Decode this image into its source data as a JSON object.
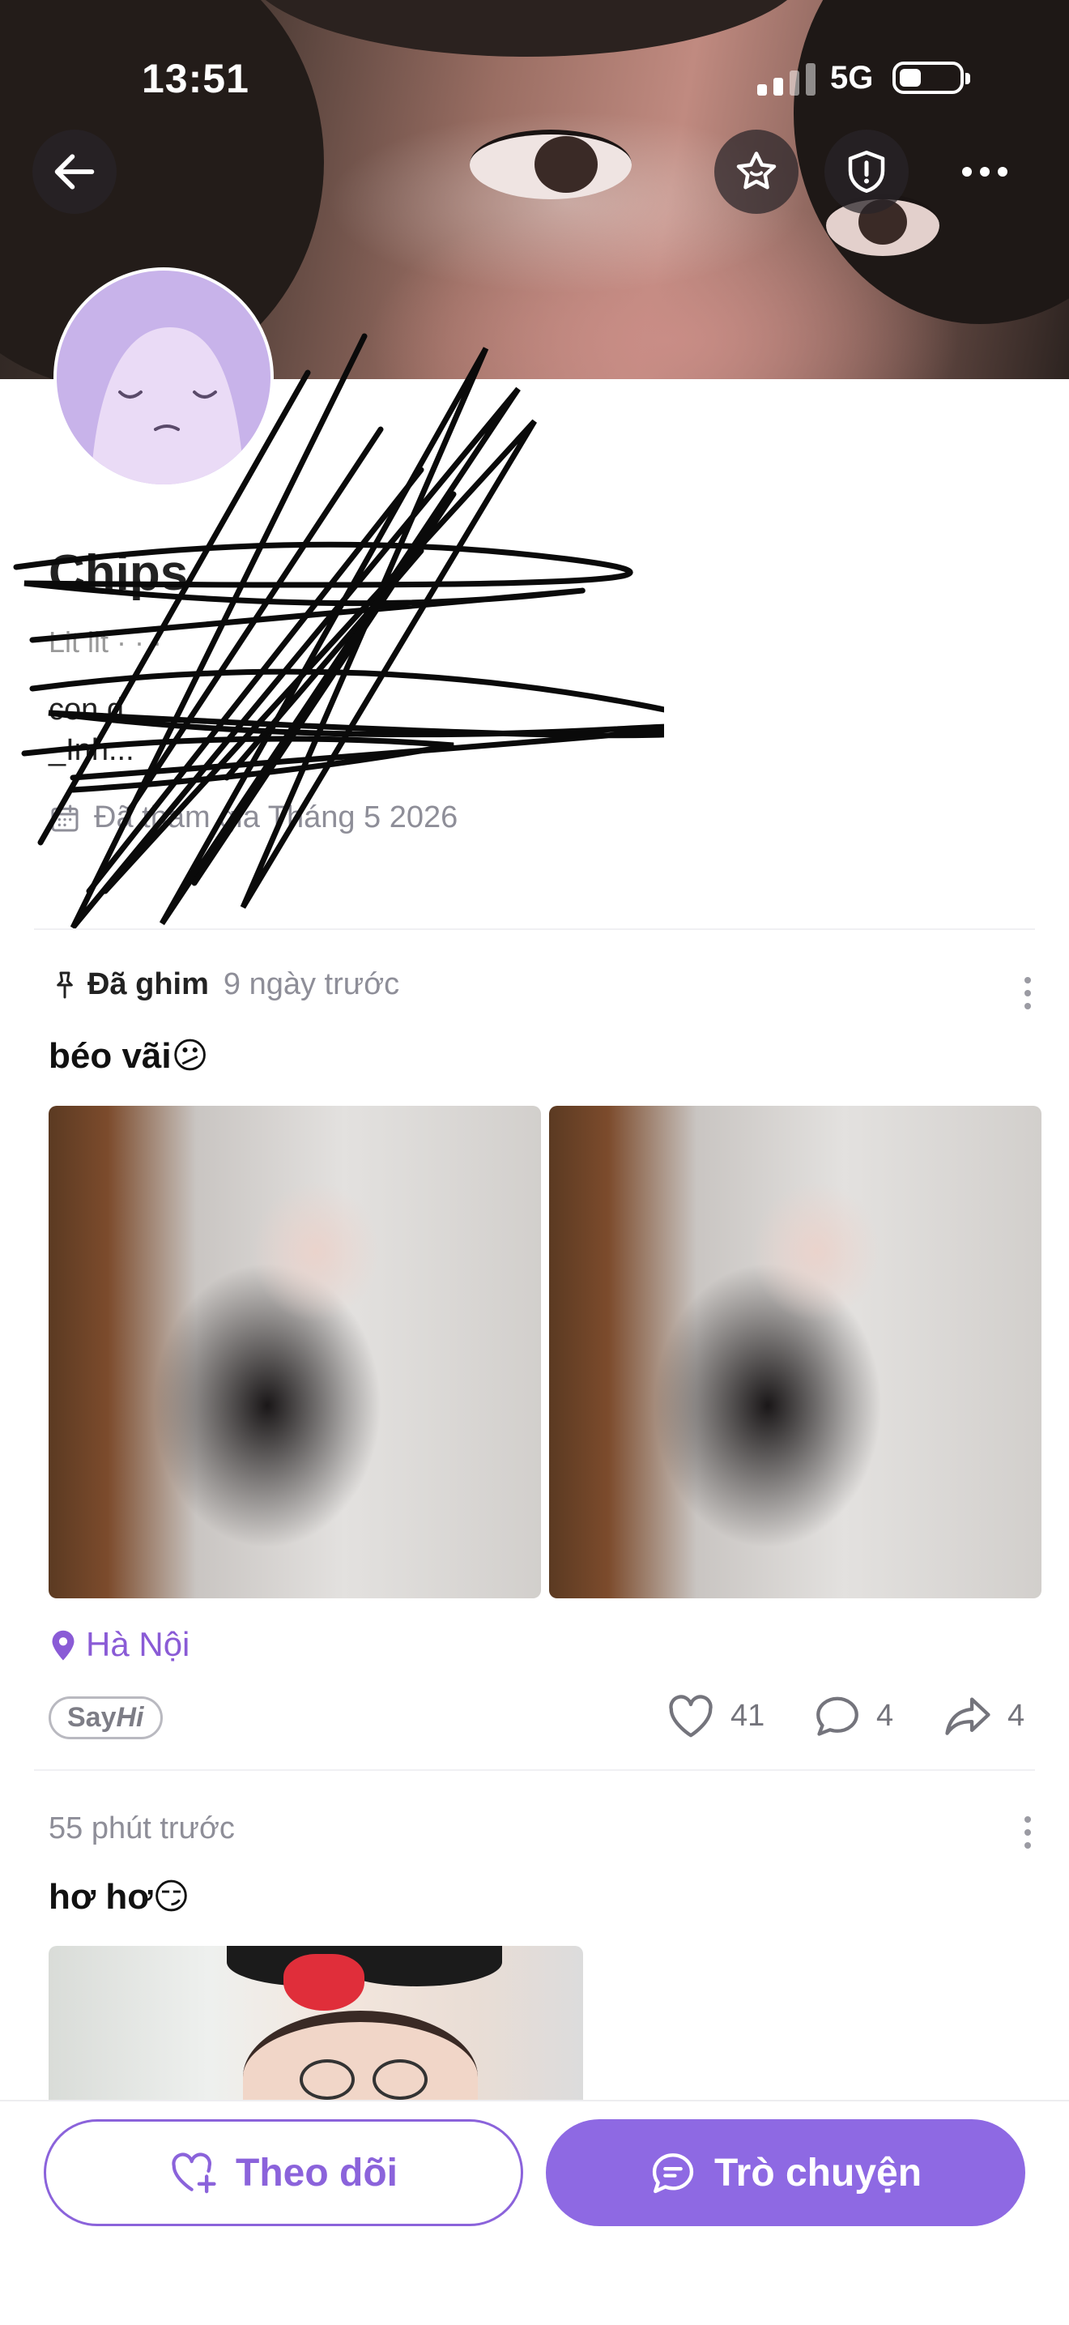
{
  "status_bar": {
    "time": "13:51",
    "network": "5G"
  },
  "profile": {
    "display_name": "Chips",
    "handle_line": "Lit lit · · ·",
    "bio_line1": "con d...",
    "bio_line2": "_Inh...",
    "joined": "Đã tham gia Tháng 5 2026"
  },
  "posts": [
    {
      "pinned_label": "Đã ghim",
      "time_ago": "9 ngày trước",
      "text": "béo vãi😕",
      "location": "Hà Nội",
      "tag_bold": "Say",
      "tag_italic": "Hi",
      "likes": "41",
      "comments": "4",
      "shares": "4"
    },
    {
      "time_ago": "55 phút trước",
      "text": "hơ hơ😏"
    }
  ],
  "actions": {
    "follow_label": "Theo dõi",
    "chat_label": "Trò chuyện"
  },
  "colors": {
    "accent": "#8e69e3",
    "location": "#8a5bd6"
  },
  "icons": [
    "back-arrow-icon",
    "star-icon",
    "shield-alert-icon",
    "more-icon",
    "calendar-icon",
    "pin-icon",
    "location-pin-icon",
    "heart-icon",
    "comment-icon",
    "share-icon",
    "heart-plus-icon",
    "chat-icon"
  ]
}
